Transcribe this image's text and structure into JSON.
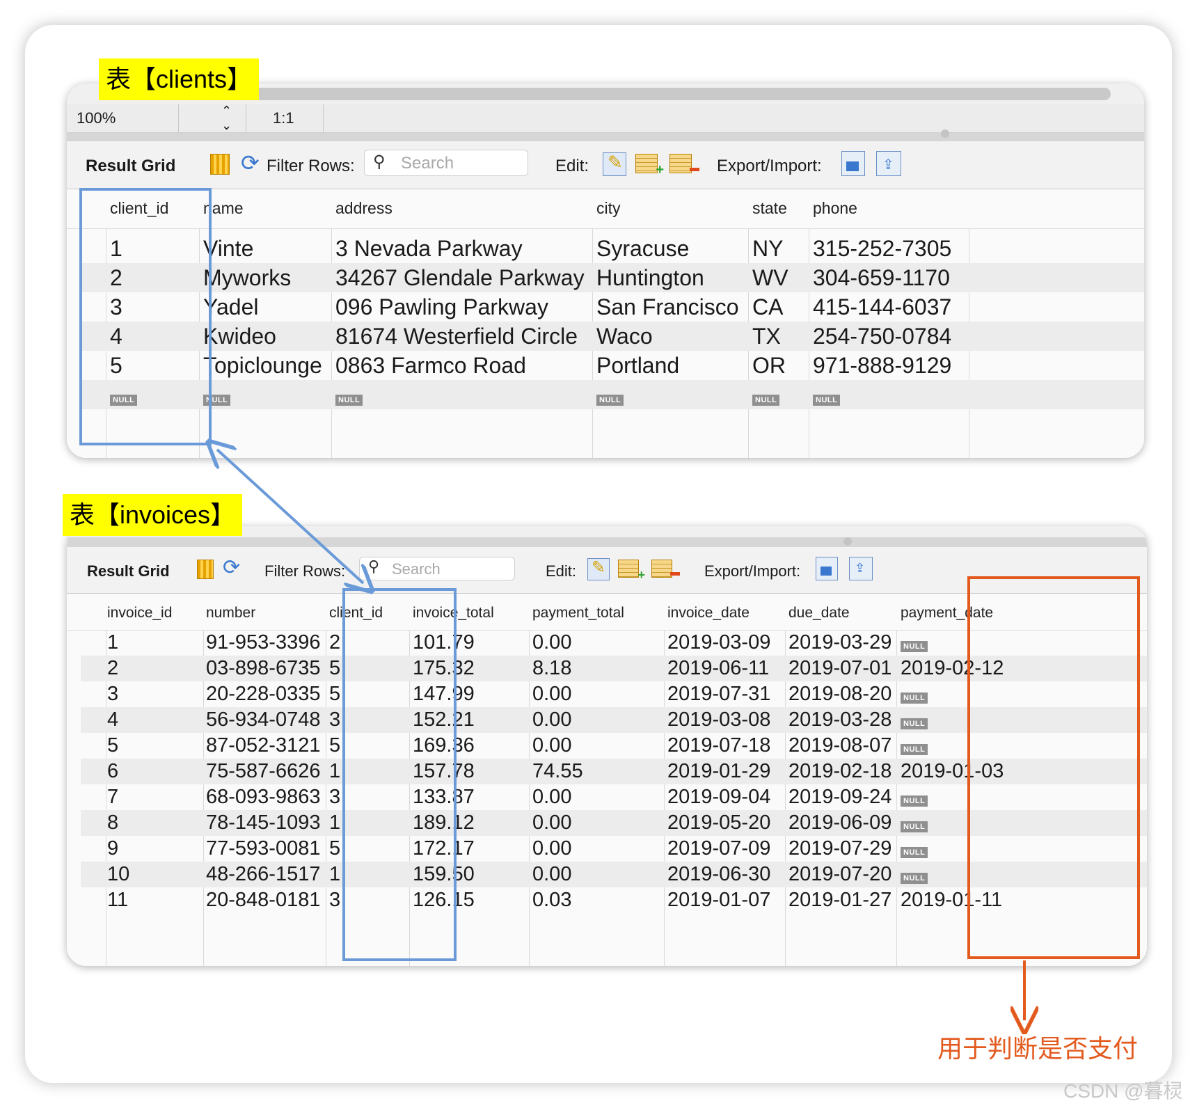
{
  "labels": {
    "clients_tag": "表【clients】",
    "invoices_tag": "表【invoices】",
    "note": "用于判断是否支付",
    "watermark": "CSDN @暮棂"
  },
  "zoom": {
    "value": "100%",
    "ratio": "1:1"
  },
  "toolbar": {
    "result_grid": "Result Grid",
    "filter_rows": "Filter Rows:",
    "search_placeholder": "Search",
    "edit": "Edit:",
    "export_import": "Export/Import:"
  },
  "null_label": "NULL",
  "clients": {
    "columns": [
      "client_id",
      "name",
      "address",
      "city",
      "state",
      "phone"
    ],
    "rows": [
      [
        "1",
        "Vinte",
        "3 Nevada Parkway",
        "Syracuse",
        "NY",
        "315-252-7305"
      ],
      [
        "2",
        "Myworks",
        "34267 Glendale Parkway",
        "Huntington",
        "WV",
        "304-659-1170"
      ],
      [
        "3",
        "Yadel",
        "096 Pawling Parkway",
        "San Francisco",
        "CA",
        "415-144-6037"
      ],
      [
        "4",
        "Kwideo",
        "81674 Westerfield Circle",
        "Waco",
        "TX",
        "254-750-0784"
      ],
      [
        "5",
        "Topiclounge",
        "0863 Farmco Road",
        "Portland",
        "OR",
        "971-888-9129"
      ]
    ]
  },
  "invoices": {
    "columns": [
      "invoice_id",
      "number",
      "client_id",
      "invoice_total",
      "payment_total",
      "invoice_date",
      "due_date",
      "payment_date"
    ],
    "rows": [
      [
        "1",
        "91-953-3396",
        "2",
        "101.79",
        "0.00",
        "2019-03-09",
        "2019-03-29",
        null
      ],
      [
        "2",
        "03-898-6735",
        "5",
        "175.32",
        "8.18",
        "2019-06-11",
        "2019-07-01",
        "2019-02-12"
      ],
      [
        "3",
        "20-228-0335",
        "5",
        "147.99",
        "0.00",
        "2019-07-31",
        "2019-08-20",
        null
      ],
      [
        "4",
        "56-934-0748",
        "3",
        "152.21",
        "0.00",
        "2019-03-08",
        "2019-03-28",
        null
      ],
      [
        "5",
        "87-052-3121",
        "5",
        "169.36",
        "0.00",
        "2019-07-18",
        "2019-08-07",
        null
      ],
      [
        "6",
        "75-587-6626",
        "1",
        "157.78",
        "74.55",
        "2019-01-29",
        "2019-02-18",
        "2019-01-03"
      ],
      [
        "7",
        "68-093-9863",
        "3",
        "133.87",
        "0.00",
        "2019-09-04",
        "2019-09-24",
        null
      ],
      [
        "8",
        "78-145-1093",
        "1",
        "189.12",
        "0.00",
        "2019-05-20",
        "2019-06-09",
        null
      ],
      [
        "9",
        "77-593-0081",
        "5",
        "172.17",
        "0.00",
        "2019-07-09",
        "2019-07-29",
        null
      ],
      [
        "10",
        "48-266-1517",
        "1",
        "159.50",
        "0.00",
        "2019-06-30",
        "2019-07-20",
        null
      ],
      [
        "11",
        "20-848-0181",
        "3",
        "126.15",
        "0.03",
        "2019-01-07",
        "2019-01-27",
        "2019-01-11"
      ]
    ]
  },
  "colors": {
    "tag_bg": "#ffff00",
    "blue_highlight": "#6a9bd8",
    "orange_highlight": "#e35a1e"
  }
}
